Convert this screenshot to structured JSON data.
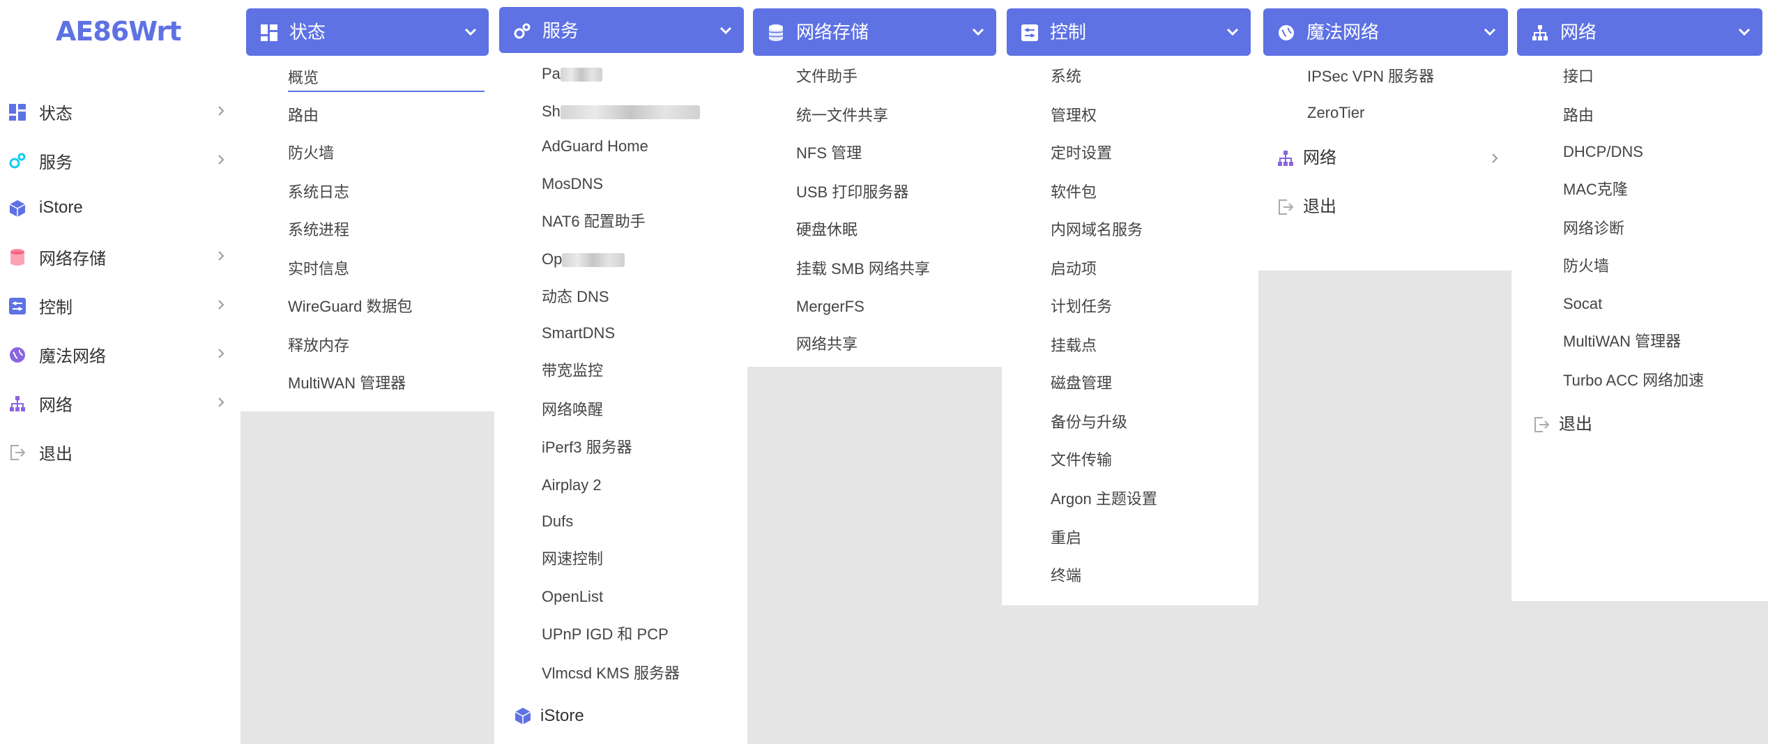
{
  "app": {
    "logo": "AE86Wrt"
  },
  "colors": {
    "accent": "#5e72e4",
    "background": "#e5e5e5"
  },
  "sidebar": {
    "items": [
      {
        "label": "状态",
        "icon": "dashboard-icon"
      },
      {
        "label": "服务",
        "icon": "gears-icon"
      },
      {
        "label": "iStore",
        "icon": "cube-icon"
      },
      {
        "label": "网络存储",
        "icon": "database-icon"
      },
      {
        "label": "控制",
        "icon": "sliders-icon"
      },
      {
        "label": "魔法网络",
        "icon": "magic-globe-icon"
      },
      {
        "label": "网络",
        "icon": "network-icon"
      },
      {
        "label": "退出",
        "icon": "logout-icon"
      }
    ]
  },
  "menus": {
    "status": {
      "title": "状态",
      "items": [
        "概览",
        "路由",
        "防火墙",
        "系统日志",
        "系统进程",
        "实时信息",
        "WireGuard 数据包",
        "释放内存",
        "MultiWAN 管理器"
      ]
    },
    "services": {
      "title": "服务",
      "items": [
        "Pa",
        "Sh",
        "AdGuard Home",
        "MosDNS",
        "NAT6 配置助手",
        "Op",
        "动态 DNS",
        "SmartDNS",
        "带宽监控",
        "网络唤醒",
        "iPerf3 服务器",
        "Airplay 2",
        "Dufs",
        "网速控制",
        "OpenList",
        "UPnP IGD 和 PCP",
        "Vlmcsd KMS 服务器"
      ],
      "footer": "iStore"
    },
    "nas": {
      "title": "网络存储",
      "items": [
        "文件助手",
        "统一文件共享",
        "NFS 管理",
        "USB 打印服务器",
        "硬盘休眠",
        "挂载 SMB 网络共享",
        "MergerFS",
        "网络共享"
      ]
    },
    "control": {
      "title": "控制",
      "items": [
        "系统",
        "管理权",
        "定时设置",
        "软件包",
        "内网域名服务",
        "启动项",
        "计划任务",
        "挂载点",
        "磁盘管理",
        "备份与升级",
        "文件传输",
        "Argon 主题设置",
        "重启",
        "终端"
      ]
    },
    "magic": {
      "title": "魔法网络",
      "items": [
        "IPSec VPN 服务器",
        "ZeroTier"
      ],
      "sub_network": "网络",
      "sub_logout": "退出"
    },
    "network": {
      "title": "网络",
      "items": [
        "接口",
        "路由",
        "DHCP/DNS",
        "MAC克隆",
        "网络诊断",
        "防火墙",
        "Socat",
        "MultiWAN 管理器",
        "Turbo ACC 网络加速"
      ],
      "sub_logout": "退出"
    }
  }
}
